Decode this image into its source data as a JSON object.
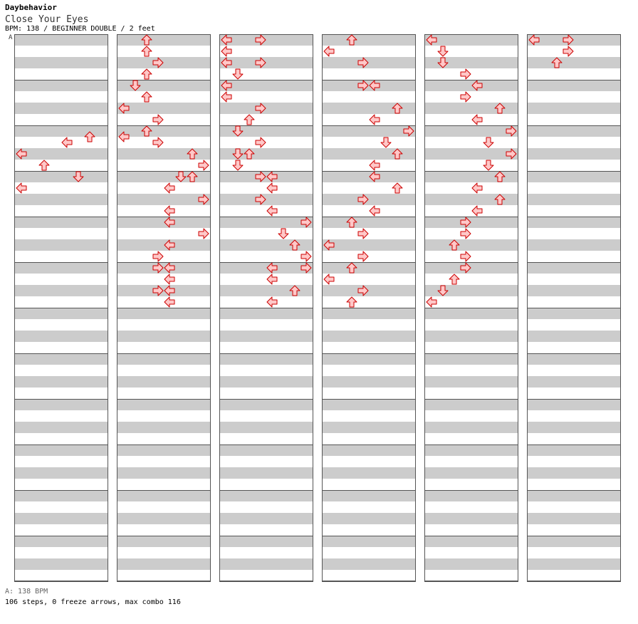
{
  "header": {
    "artist": "Daybehavior",
    "title": "Close Your Eyes",
    "info": "BPM: 138 / BEGINNER DOUBLE / 2 feet",
    "bpm_marker": "A"
  },
  "footer": {
    "bpm": "A: 138 BPM",
    "stats": "106 steps, 0 freeze arrows, max combo 116"
  },
  "colors": {
    "stripe": "#cccccc",
    "arrow_fill": "#ffc8c8",
    "arrow_stroke": "#cc0000",
    "border": "#555555"
  },
  "lanes": [
    "left",
    "down",
    "up",
    "right",
    "left",
    "down",
    "up",
    "right"
  ],
  "notes": [
    [
      [
        8.5,
        6
      ],
      [
        9,
        4
      ],
      [
        10,
        0
      ],
      [
        11,
        2
      ],
      [
        12,
        5
      ],
      [
        13,
        0
      ]
    ],
    [
      [
        0,
        2
      ],
      [
        1,
        2
      ],
      [
        2,
        3
      ],
      [
        3,
        2
      ],
      [
        4,
        1
      ],
      [
        5,
        2
      ],
      [
        6,
        0
      ],
      [
        7,
        3
      ],
      [
        8,
        2
      ],
      [
        8.5,
        0
      ],
      [
        9,
        3
      ],
      [
        10,
        6
      ],
      [
        11,
        7
      ],
      [
        12,
        5
      ],
      [
        12,
        6
      ],
      [
        13,
        4
      ],
      [
        14,
        7
      ],
      [
        15,
        4
      ],
      [
        16,
        4
      ],
      [
        17,
        7
      ],
      [
        18,
        4
      ],
      [
        19,
        3
      ],
      [
        20,
        3
      ],
      [
        20,
        4
      ],
      [
        21,
        4
      ],
      [
        22,
        3
      ],
      [
        22,
        4
      ],
      [
        23,
        4
      ]
    ],
    [
      [
        0,
        0
      ],
      [
        0,
        3
      ],
      [
        1,
        0
      ],
      [
        2,
        0
      ],
      [
        2,
        3
      ],
      [
        3,
        1
      ],
      [
        4,
        0
      ],
      [
        5,
        0
      ],
      [
        6,
        3
      ],
      [
        7,
        2
      ],
      [
        8,
        1
      ],
      [
        9,
        3
      ],
      [
        10,
        1
      ],
      [
        10,
        2
      ],
      [
        11,
        1
      ],
      [
        12,
        3
      ],
      [
        12,
        4
      ],
      [
        13,
        4
      ],
      [
        14,
        3
      ],
      [
        15,
        4
      ],
      [
        16,
        7
      ],
      [
        17,
        5
      ],
      [
        18,
        6
      ],
      [
        19,
        7
      ],
      [
        20,
        4
      ],
      [
        20,
        7
      ],
      [
        21,
        4
      ],
      [
        22,
        6
      ],
      [
        23,
        4
      ]
    ],
    [
      [
        0,
        2
      ],
      [
        1,
        0
      ],
      [
        2,
        3
      ],
      [
        4,
        3
      ],
      [
        4,
        4
      ],
      [
        6,
        6
      ],
      [
        7,
        4
      ],
      [
        8,
        7
      ],
      [
        9,
        5
      ],
      [
        10,
        6
      ],
      [
        11,
        4
      ],
      [
        12,
        4
      ],
      [
        13,
        6
      ],
      [
        14,
        3
      ],
      [
        15,
        4
      ],
      [
        16,
        2
      ],
      [
        17,
        3
      ],
      [
        18,
        0
      ],
      [
        19,
        3
      ],
      [
        20,
        2
      ],
      [
        21,
        0
      ],
      [
        22,
        3
      ],
      [
        23,
        2
      ]
    ],
    [
      [
        0,
        0
      ],
      [
        1,
        1
      ],
      [
        2,
        1
      ],
      [
        3,
        3
      ],
      [
        4,
        4
      ],
      [
        5,
        3
      ],
      [
        6,
        6
      ],
      [
        7,
        4
      ],
      [
        8,
        7
      ],
      [
        9,
        5
      ],
      [
        10,
        7
      ],
      [
        11,
        5
      ],
      [
        12,
        6
      ],
      [
        13,
        4
      ],
      [
        14,
        6
      ],
      [
        15,
        4
      ],
      [
        16,
        3
      ],
      [
        17,
        3
      ],
      [
        18,
        2
      ],
      [
        19,
        3
      ],
      [
        20,
        3
      ],
      [
        21,
        2
      ],
      [
        22,
        1
      ],
      [
        23,
        0
      ]
    ],
    [
      [
        0,
        0
      ],
      [
        0,
        3
      ],
      [
        1,
        3
      ],
      [
        2,
        2
      ]
    ]
  ]
}
